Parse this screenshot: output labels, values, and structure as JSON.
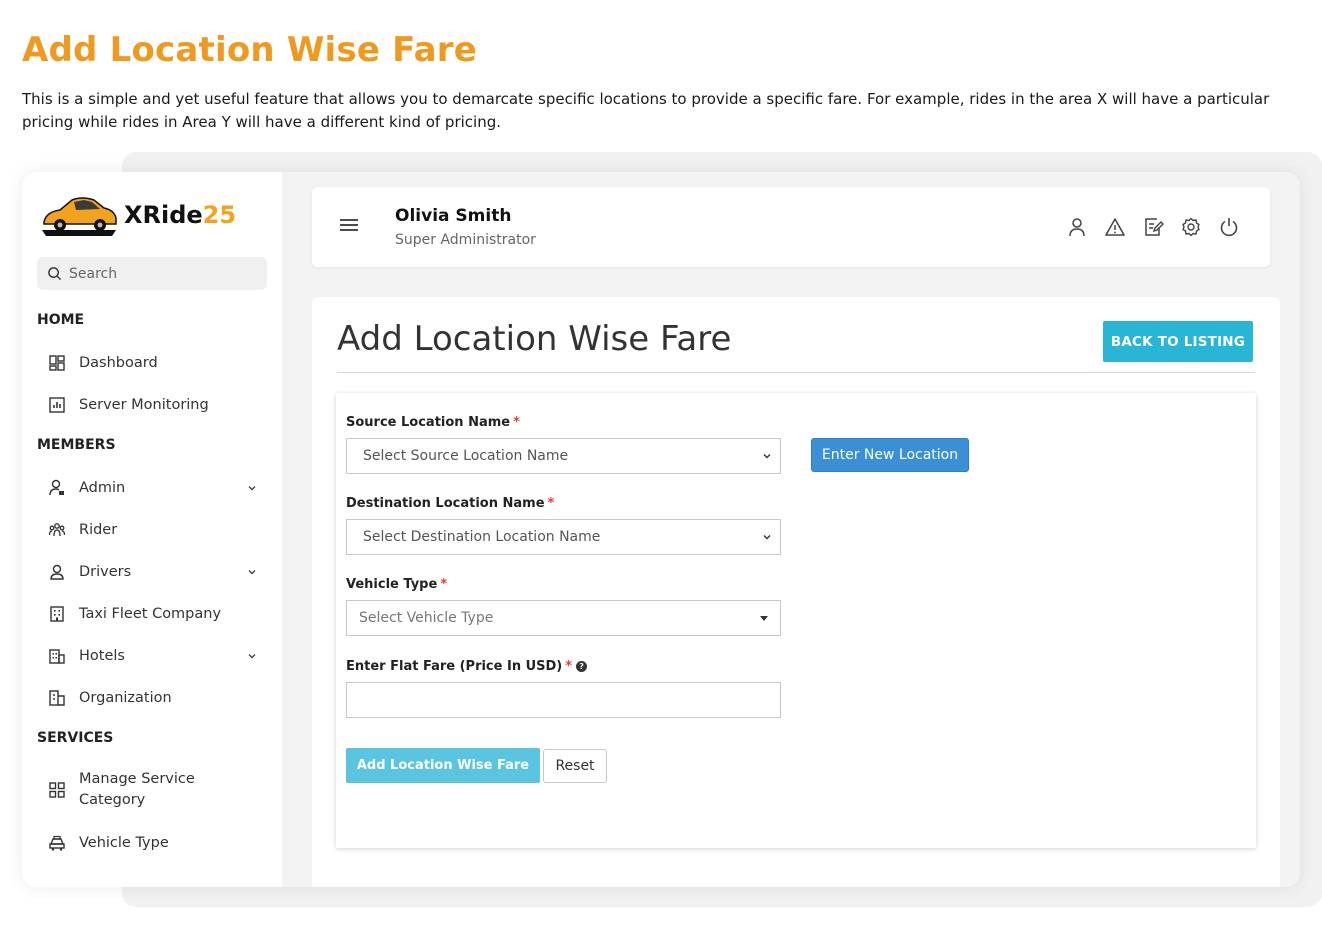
{
  "promo": {
    "title": "Add Location Wise Fare",
    "description": "This is a simple and yet useful feature that allows you to demarcate specific locations to provide a specific fare. For example, rides in the area X will have a particular pricing while rides in Area Y will have a different kind of pricing."
  },
  "brand": {
    "name": "XRide",
    "number": "25",
    "accent": "#f2a21c"
  },
  "search": {
    "placeholder": "Search"
  },
  "sidebar": {
    "sections": {
      "home": "HOME",
      "members": "MEMBERS",
      "services": "SERVICES"
    },
    "items": {
      "dashboard": "Dashboard",
      "server_monitoring": "Server Monitoring",
      "admin": "Admin",
      "rider": "Rider",
      "drivers": "Drivers",
      "taxi_fleet": "Taxi Fleet Company",
      "hotels": "Hotels",
      "organization": "Organization",
      "manage_service_line1": "Manage Service",
      "manage_service_line2": "Category",
      "vehicle_type": "Vehicle Type"
    }
  },
  "header": {
    "user_name": "Olivia Smith",
    "user_role": "Super Administrator"
  },
  "page": {
    "title": "Add Location Wise Fare",
    "back_button": "BACK TO LISTING"
  },
  "form": {
    "source_label": "Source Location Name",
    "source_placeholder": "Select Source Location Name",
    "new_location_button": "Enter New Location",
    "destination_label": "Destination Location Name",
    "destination_placeholder": "Select Destination Location Name",
    "vehicle_label": "Vehicle Type",
    "vehicle_placeholder": "Select Vehicle Type",
    "fare_label": "Enter Flat Fare (Price In USD)",
    "fare_value": "",
    "required_mark": "*",
    "help_mark": "?",
    "submit_button": "Add Location Wise Fare",
    "reset_button": "Reset"
  },
  "colors": {
    "promo_title": "#ef9a1f",
    "back_button": "#29b6d6",
    "new_location_button": "#3a8fd6",
    "submit_button": "#5bc4e0",
    "required": "#e53935"
  }
}
